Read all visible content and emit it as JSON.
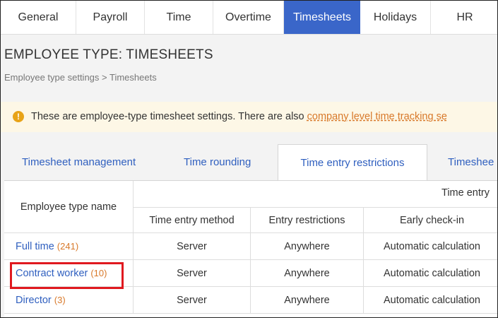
{
  "top_tabs": [
    {
      "label": "General"
    },
    {
      "label": "Payroll"
    },
    {
      "label": "Time"
    },
    {
      "label": "Overtime"
    },
    {
      "label": "Timesheets",
      "active": true
    },
    {
      "label": "Holidays"
    },
    {
      "label": "HR"
    }
  ],
  "page": {
    "title": "EMPLOYEE TYPE: TIMESHEETS",
    "breadcrumb": "Employee type settings > Timesheets"
  },
  "notice": {
    "icon": "info-icon",
    "text": "These are employee-type timesheet settings. There are also ",
    "link": "company level time tracking se"
  },
  "sub_tabs": [
    {
      "label": "Timesheet management"
    },
    {
      "label": "Time rounding"
    },
    {
      "label": "Time entry restrictions",
      "active": true
    },
    {
      "label": "Timeshee"
    }
  ],
  "table": {
    "name_header": "Employee type name",
    "group_header": "Time entry",
    "columns": [
      "Time entry method",
      "Entry restrictions",
      "Early check-in"
    ],
    "rows": [
      {
        "name": "Full time",
        "count": "(241)",
        "method": "Server",
        "restriction": "Anywhere",
        "early": "Automatic calculation"
      },
      {
        "name": "Contract worker",
        "count": "(10)",
        "method": "Server",
        "restriction": "Anywhere",
        "early": "Automatic calculation"
      },
      {
        "name": "Director",
        "count": "(3)",
        "method": "Server",
        "restriction": "Anywhere",
        "early": "Automatic calculation"
      }
    ]
  },
  "colors": {
    "accent": "#3a66c9",
    "link": "#2f5fbf",
    "count": "#d8792a",
    "highlight": "#e0191f"
  }
}
